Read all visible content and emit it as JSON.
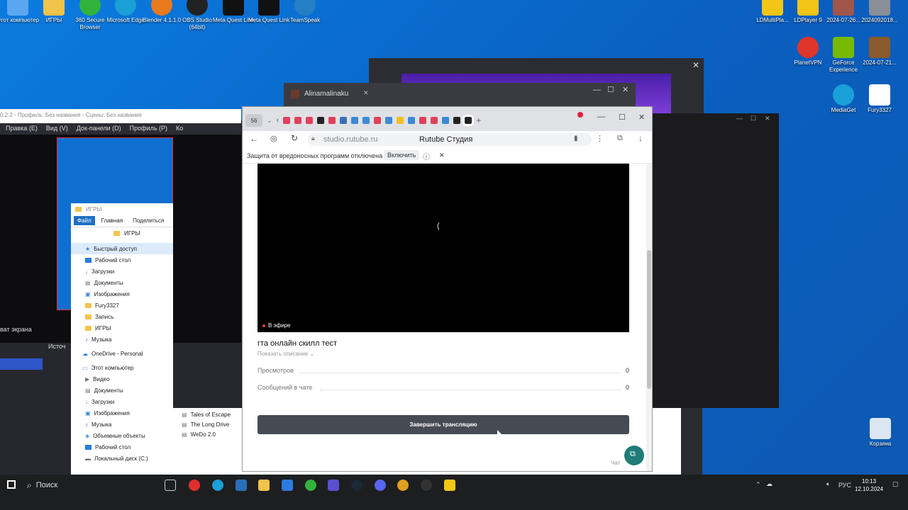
{
  "desktop": {
    "top_icons": [
      {
        "label": "Этот компьютер"
      },
      {
        "label": "ИГРЫ"
      },
      {
        "label": "360 Secure Browser"
      },
      {
        "label": "Microsoft Edge"
      },
      {
        "label": "Blender 4.1.1.0"
      },
      {
        "label": "OBS Studio (64bit)"
      },
      {
        "label": "Meta Quest Link"
      },
      {
        "label": "Meta Quest Link"
      },
      {
        "label": "TeamSpeak"
      }
    ],
    "right_icons": [
      {
        "label": "LDMultiPla..."
      },
      {
        "label": "LDPlayer 9"
      },
      {
        "label": "2024-07-26..."
      },
      {
        "label": "2024092018..."
      },
      {
        "label": "PlanetVPN"
      },
      {
        "label": "GeForce Experience"
      },
      {
        "label": "2024-07-21..."
      },
      {
        "label": "MediaGet"
      },
      {
        "label": "Fury3327"
      },
      {
        "label": "Корзина"
      }
    ]
  },
  "obs": {
    "title": "0.2.2 - Профиль: Без названия - Сцены: Без названия",
    "menu": [
      "Правка (E)",
      "Вид (V)",
      "Док-панели (D)",
      "Профиль (P)",
      "Ко"
    ],
    "capture_label": "ват экрана",
    "sources_label": "Источ"
  },
  "explorer": {
    "path": "ИГРЫ",
    "title": "ИГРЫ",
    "tabs": [
      "Файл",
      "Главная",
      "Поделиться"
    ],
    "items": [
      {
        "label": "Быстрый доступ",
        "type": "star"
      },
      {
        "label": "Рабочий стол",
        "type": "blue"
      },
      {
        "label": "Загрузки",
        "type": "down"
      },
      {
        "label": "Документы",
        "type": "doc"
      },
      {
        "label": "Изображения",
        "type": "img"
      },
      {
        "label": "Fury3327",
        "type": "folder"
      },
      {
        "label": "Запись",
        "type": "folder"
      },
      {
        "label": "ИГРЫ",
        "type": "folder"
      },
      {
        "label": "Музыка",
        "type": "music"
      },
      {
        "label": "OneDrive - Personal",
        "type": "cloud"
      },
      {
        "label": "Этот компьютер",
        "type": "pc"
      },
      {
        "label": "Видео",
        "type": "video"
      },
      {
        "label": "Документы",
        "type": "doc"
      },
      {
        "label": "Загрузки",
        "type": "down"
      },
      {
        "label": "Изображения",
        "type": "img"
      },
      {
        "label": "Музыка",
        "type": "music"
      },
      {
        "label": "Объемные объекты",
        "type": "cube"
      },
      {
        "label": "Рабочий стол",
        "type": "blue"
      },
      {
        "label": "Локальный диск (C:)",
        "type": "disk"
      }
    ]
  },
  "file_list": [
    "Tales of Escape",
    "The Long Drive",
    "WeDo 2.0"
  ],
  "back_window": {
    "tab_title": "Alinamalinaku"
  },
  "browser": {
    "tab_count": "56",
    "url": "studio.rutube.ru",
    "page_title": "Rutube Студия",
    "warning_text": "Защита от вредоносных программ отключена",
    "enable_button": "Включить",
    "live_badge": "В эфире",
    "stream_title": "гта онлайн скилл тест",
    "show_description": "Показать описание",
    "stats": [
      {
        "label": "Просмотров",
        "value": "0"
      },
      {
        "label": "Сообщений в чате",
        "value": "0"
      }
    ],
    "end_button": "Завершить трансляцию",
    "chat_label": "Чат"
  },
  "taskbar": {
    "search_placeholder": "Поиск",
    "lang": "РУС",
    "time": "10:13",
    "date": "12.10.2024"
  }
}
